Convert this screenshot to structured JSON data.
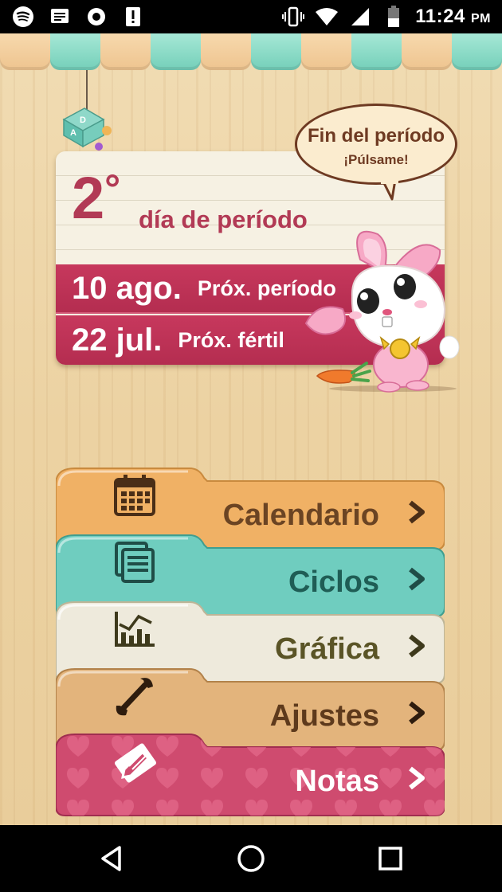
{
  "status": {
    "time": "11:24",
    "ampm": "PM",
    "icons": [
      "spotify-icon",
      "message-icon",
      "circle-app-icon",
      "alert-icon",
      "vibrate-icon",
      "wifi-icon",
      "signal-icon",
      "battery-icon"
    ]
  },
  "card": {
    "day_number": "2",
    "day_degree": "°",
    "day_text": "día de período",
    "next_period_date": "10 ago.",
    "next_period_label": "Próx. período",
    "next_fertile_date": "22 jul.",
    "next_fertile_label": "Próx. fértil"
  },
  "bubble": {
    "title": "Fin del período",
    "subtitle": "¡Púlsame!"
  },
  "menu": [
    {
      "label": "Calendario",
      "icon": "calendar-icon",
      "color": "#f0b165",
      "text_color": "#6b4423"
    },
    {
      "label": "Ciclos",
      "icon": "cycles-icon",
      "color": "#6fcdbf",
      "text_color": "#1f5d55"
    },
    {
      "label": "Gráfica",
      "icon": "chart-icon",
      "color": "#eeeadc",
      "text_color": "#5a5426"
    },
    {
      "label": "Ajustes",
      "icon": "wrench-icon",
      "color": "#e3b47c",
      "text_color": "#5e3a1c"
    },
    {
      "label": "Notas",
      "icon": "pencil-icon",
      "color": "#cf4b6f",
      "text_color": "#ffffff"
    }
  ],
  "colors": {
    "accent": "#b23a55",
    "wood": "#ecd2a2"
  }
}
